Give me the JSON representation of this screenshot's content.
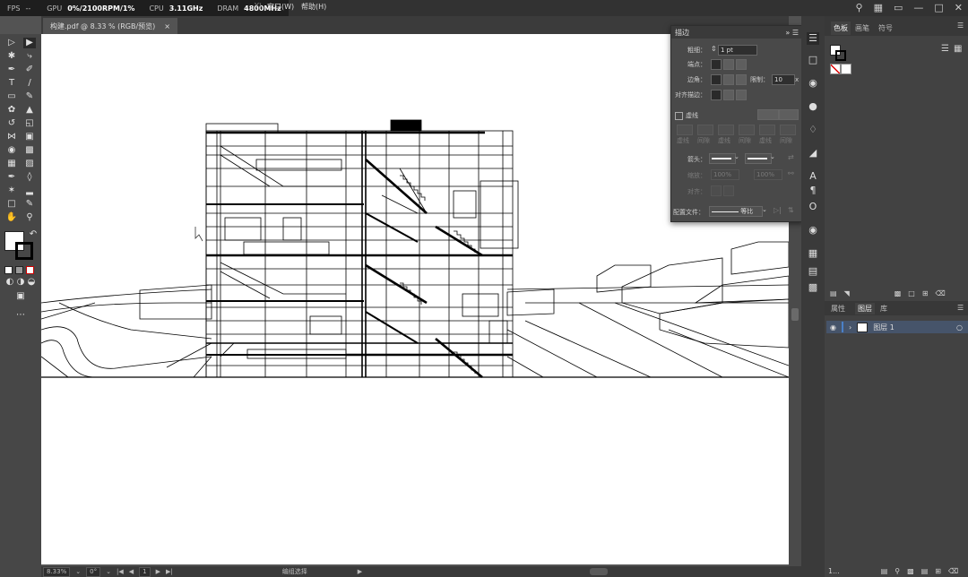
{
  "perf": {
    "fps_label": "FPS",
    "fps_value": "--",
    "gpu_label": "GPU",
    "gpu_value": "0%/2100RPM/1%",
    "cpu_label": "CPU",
    "cpu_value": "3.11GHz",
    "dram_label": "DRAM",
    "dram_value": "4800MHz"
  },
  "menu": {
    "partial": "Y)",
    "window": "窗口(W)",
    "help": "帮助(H)"
  },
  "document": {
    "tab_title": "构建.pdf @ 8.33 % (RGB/预览)",
    "close": "×"
  },
  "stroke_panel": {
    "title": "描边",
    "weight_label": "粗细：",
    "weight_value": "1 pt",
    "cap_label": "端点：",
    "corner_label": "边角：",
    "limit_label": "限制：",
    "limit_value": "10",
    "limit_unit": "x",
    "align_label": "对齐描边：",
    "dashed_label": "虚线",
    "dash_labels": [
      "虚线",
      "间隙",
      "虚线",
      "间隙",
      "虚线",
      "间隙"
    ],
    "arrow_label": "箭头：",
    "scale_label": "缩放：",
    "scale_value_1": "100%",
    "scale_value_2": "100%",
    "align_label2": "对齐：",
    "profile_label": "配置文件：",
    "profile_value": "等比"
  },
  "swatches_panel": {
    "tabs": [
      "色板",
      "画笔",
      "符号"
    ]
  },
  "layers_panel": {
    "tabs": [
      "属性",
      "图层",
      "库"
    ],
    "layer_name": "图层 1",
    "footer_count": "1..."
  },
  "status": {
    "zoom": "8.33%",
    "rotate": "0°",
    "artboard": "1",
    "tool_hint": "编组选择"
  },
  "topright_icons": [
    "search-icon",
    "arrange-icon",
    "workspace-icon",
    "minimize-icon",
    "restore-icon",
    "close-icon"
  ],
  "colors": {
    "accent": "#4a80c8",
    "artboard": "#ffffff",
    "ui_dark": "#323232",
    "ui_mid": "#535353"
  }
}
